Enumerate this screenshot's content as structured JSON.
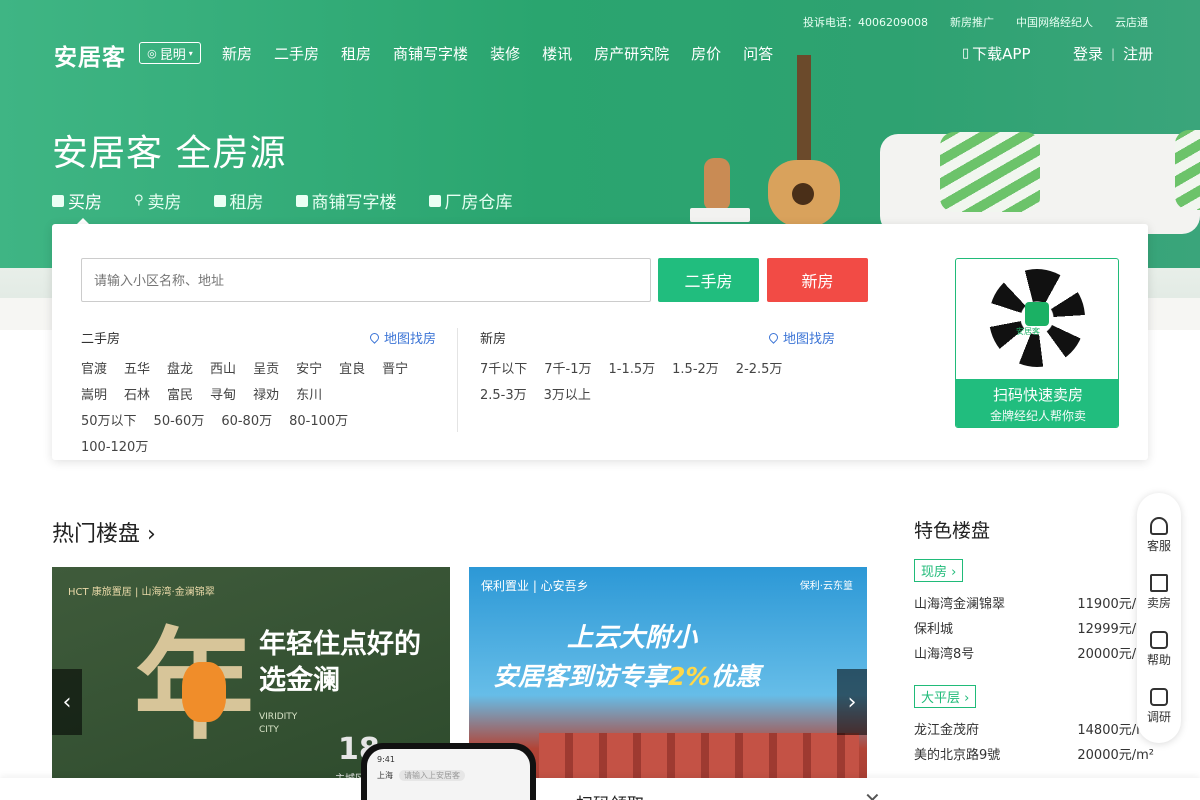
{
  "topbar": {
    "complaint": "投诉电话：4006209008",
    "promo": "新房推广",
    "agent": "中国网络经纪人",
    "store": "云店通"
  },
  "logo": "安居客",
  "city": "昆明",
  "nav": [
    "新房",
    "二手房",
    "租房",
    "商铺写字楼",
    "装修",
    "楼讯",
    "房产研究院",
    "房价",
    "问答"
  ],
  "download": "下载APP",
  "login": "登录",
  "register": "注册",
  "slogan": "安居客 全房源",
  "tabs": [
    "买房",
    "卖房",
    "租房",
    "商铺写字楼",
    "厂房仓库"
  ],
  "search": {
    "placeholder": "请输入小区名称、地址",
    "btn_second": "二手房",
    "btn_new": "新房"
  },
  "second_hand": {
    "title": "二手房",
    "map": "地图找房",
    "areas": [
      "官渡",
      "五华",
      "盘龙",
      "西山",
      "呈贡",
      "安宁",
      "宜良",
      "晋宁",
      "嵩明",
      "石林",
      "富民",
      "寻甸",
      "禄劝",
      "东川"
    ],
    "prices": [
      "50万以下",
      "50-60万",
      "60-80万",
      "80-100万",
      "100-120万"
    ]
  },
  "new_house": {
    "title": "新房",
    "map": "地图找房",
    "prices": [
      "7千以下",
      "7千-1万",
      "1-1.5万",
      "1.5-2万",
      "2-2.5万",
      "2.5-3万",
      "3万以上"
    ]
  },
  "qr": {
    "logo": "安居客",
    "line1": "扫码快速卖房",
    "line2": "金牌经纪人帮你卖"
  },
  "hot_title": "热门楼盘 ›",
  "feature_title": "特色楼盘",
  "banner1": {
    "brand": "HCT 康旅置居  |  山海湾·金澜锦翠",
    "headline1": "年轻住点好的",
    "headline2": "选金澜",
    "viridity": "VIRIDITY",
    "city": "CITY",
    "num_big": "年",
    "year": "18",
    "sub": "主城区"
  },
  "banner2": {
    "brand": "保利置业 | 心安吾乡",
    "brand_right": "保利·云东篁",
    "line1": "上云大附小",
    "line2_a": "安居客到访专享",
    "line2_hl": "2%",
    "line2_b": "优惠"
  },
  "features": [
    {
      "tag": "现房 ›",
      "items": [
        {
          "name": "山海湾金澜锦翠",
          "price": "11900元/m²"
        },
        {
          "name": "保利城",
          "price": "12999元/m²"
        },
        {
          "name": "山海湾8号",
          "price": "20000元/m²"
        }
      ]
    },
    {
      "tag": "大平层 ›",
      "items": [
        {
          "name": "龙江金茂府",
          "price": "14800元/m²"
        },
        {
          "name": "美的北京路9號",
          "price": "20000元/m²"
        }
      ]
    }
  ],
  "floatbar": [
    "客服",
    "卖房",
    "帮助",
    "调研"
  ],
  "phone": {
    "time": "9:41",
    "city": "上海",
    "search": "请输入上安居客"
  },
  "bottom": {
    "text": "扫码领取",
    "close": "✕"
  }
}
